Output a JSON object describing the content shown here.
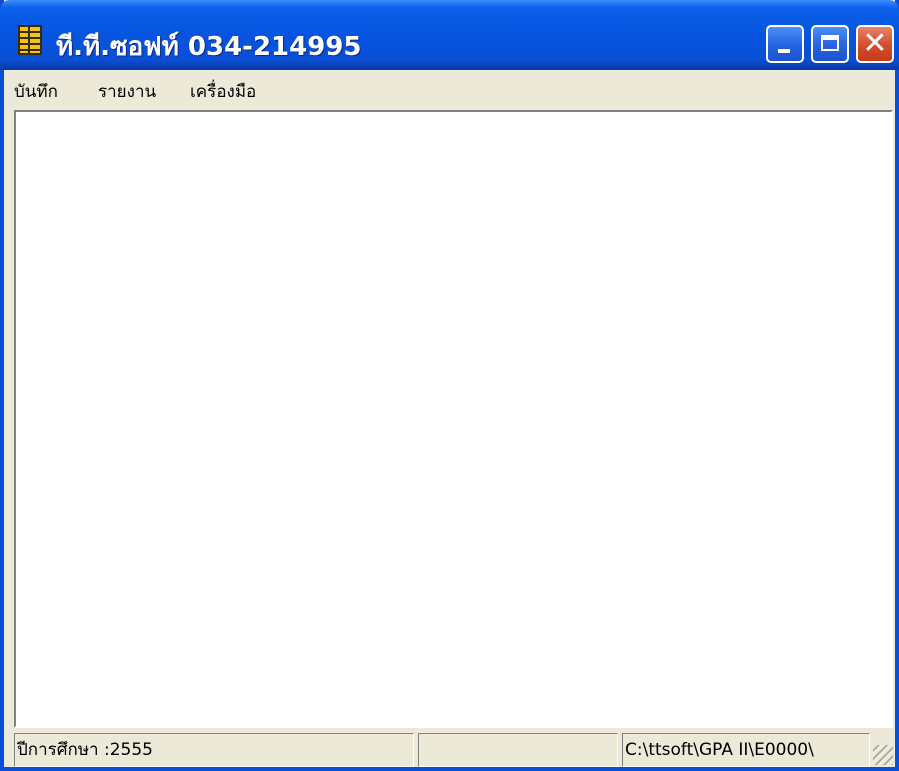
{
  "window": {
    "title": "ที.ที.ซอฟท์ 034-214995",
    "icon": "ledger-icon",
    "controls": {
      "minimize": "minimize-icon",
      "maximize": "maximize-icon",
      "close": "✕"
    }
  },
  "menu": {
    "items": [
      {
        "label": "บันทึก"
      },
      {
        "label": "รายงาน"
      },
      {
        "label": "เครื่องมือ"
      }
    ]
  },
  "statusbar": {
    "academic_year": "ปีการศึกษา :2555",
    "middle": "",
    "path": "C:\\ttsoft\\GPA II\\E0000\\"
  },
  "colors": {
    "titlebar": "#0754e0",
    "frame": "#0b4ed6",
    "chrome": "#ece9d8",
    "close_button": "#d4502f"
  }
}
